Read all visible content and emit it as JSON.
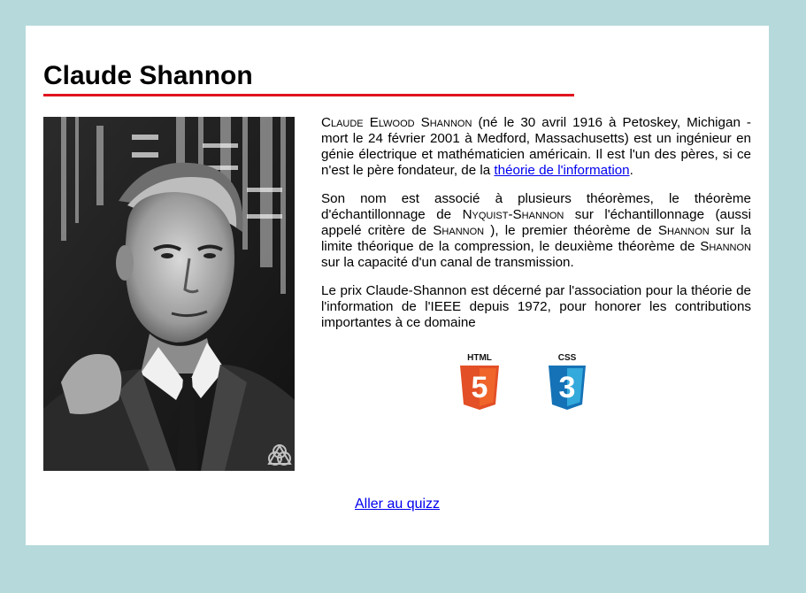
{
  "page": {
    "title": "Claude Shannon",
    "accent_color": "#e0141e",
    "background_color": "#b6dadb"
  },
  "portrait": {
    "alt": "Claude Shannon",
    "watermark_icon": "triangle-circles-icon"
  },
  "bio": {
    "p1": {
      "name": "Claude Elwood Shannon",
      "text": " (né le 30 avril 1916 à Petoskey, Michigan - mort le 24 février 2001 à Medford, Massachusetts) est un ingénieur en génie électrique et mathématicien américain. Il est l'un des pères, si ce n'est le père fondateur, de la ",
      "link": "théorie de l'information",
      "end": "."
    },
    "p2": {
      "t1": "Son nom est associé à plusieurs théorèmes, le théorème d'échantillonnage de ",
      "sc1": "Nyquist-Shannon",
      "t2": " sur l'échantillonnage (aussi appelé critère de ",
      "sc2": "Shannon",
      "t3": " ), le premier théorème de ",
      "sc3": "Shannon",
      "t4": " sur la limite théorique de la compression, le deuxième théorème de ",
      "sc4": "Shannon",
      "t5": " sur la capacité d'un canal de transmission."
    },
    "p3": "Le prix Claude-Shannon est décerné par l'association pour la théorie de l'information de l'IEEE depuis 1972, pour honorer les contributions importantes à ce domaine"
  },
  "logos": {
    "html": {
      "label": "HTML",
      "glyph": "5",
      "color": "#e34f26",
      "icon": "html5-icon"
    },
    "css": {
      "label": "CSS",
      "glyph": "3",
      "color": "#1572b6",
      "icon": "css3-icon"
    }
  },
  "footer": {
    "quiz_link": "Aller au quizz"
  }
}
